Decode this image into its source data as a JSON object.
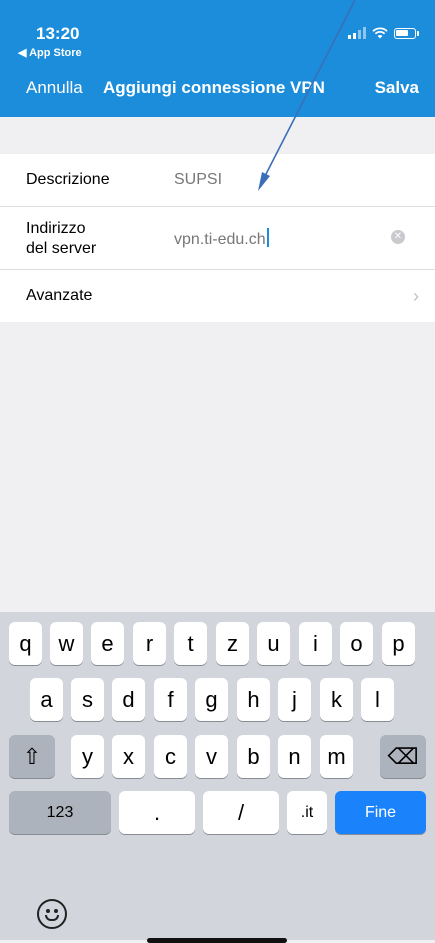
{
  "status_bar": {
    "time": "13:20",
    "back_app": "◀ App Store"
  },
  "nav": {
    "cancel": "Annulla",
    "title": "Aggiungi connessione VPN",
    "save": "Salva"
  },
  "form": {
    "description_label": "Descrizione",
    "description_value": "SUPSI",
    "server_label_line1": "Indirizzo",
    "server_label_line2": "del server",
    "server_value": "vpn.ti-edu.ch",
    "advanced_label": "Avanzate"
  },
  "icons": {
    "clear": "clear-icon",
    "chevron": "chevron-right-icon",
    "shift": "shift-icon",
    "backspace": "backspace-icon",
    "emoji": "emoji-icon"
  },
  "colors": {
    "accent": "#1c8dda",
    "done_key": "#1a82fb",
    "annotation_arrow": "#3a6fb8"
  },
  "keyboard": {
    "row1": [
      "q",
      "w",
      "e",
      "r",
      "t",
      "z",
      "u",
      "i",
      "o",
      "p"
    ],
    "row2": [
      "a",
      "s",
      "d",
      "f",
      "g",
      "h",
      "j",
      "k",
      "l"
    ],
    "row3": [
      "y",
      "x",
      "c",
      "v",
      "b",
      "n",
      "m"
    ],
    "shift": "⇧",
    "backspace": "⌫",
    "numbers": "123",
    "dot": ".",
    "slash": "/",
    "tld": ".it",
    "done": "Fine"
  }
}
